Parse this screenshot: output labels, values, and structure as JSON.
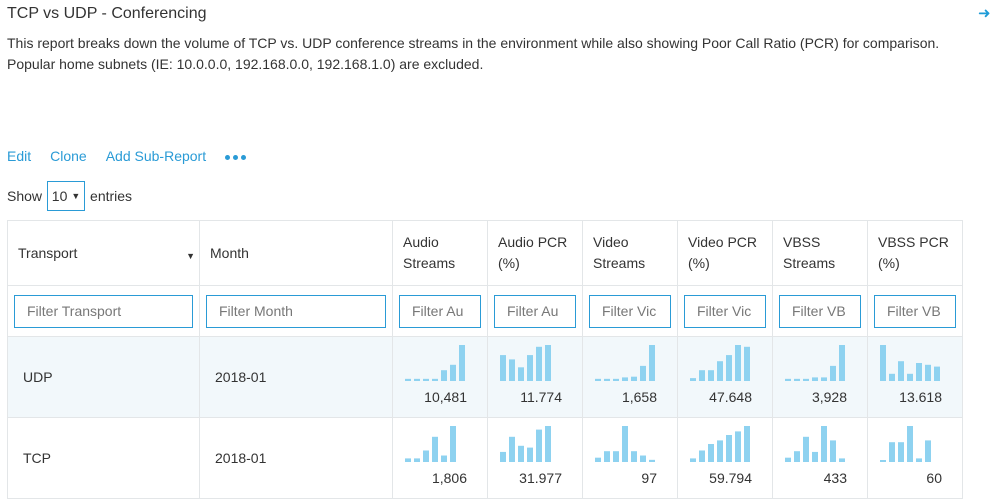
{
  "report": {
    "title": "TCP vs UDP - Conferencing",
    "description": "This report breaks down the volume of TCP vs. UDP conference streams in the environment while also showing Poor Call Ratio (PCR) for comparison. Popular home subnets (IE: 10.0.0.0, 192.168.0.0, 192.168.1.0) are excluded.",
    "open_icon": "arrow-right-icon"
  },
  "actions": {
    "edit": "Edit",
    "clone": "Clone",
    "add_sub_report": "Add Sub-Report",
    "more_icon": "more-dots-icon"
  },
  "length_menu": {
    "show": "Show",
    "value": "10",
    "entries": "entries"
  },
  "colors": {
    "accent": "#2a9bd6",
    "bar": "#8ed2f0",
    "row_highlight": "#f2f8fb"
  },
  "table": {
    "headers": [
      "Transport",
      "Month",
      "Audio Streams",
      "Audio PCR (%)",
      "Video Streams",
      "Video PCR (%)",
      "VBSS Streams",
      "VBSS PCR (%)"
    ],
    "filters": [
      "Filter Transport",
      "Filter Month",
      "Filter Au",
      "Filter Au",
      "Filter Vic",
      "Filter Vic",
      "Filter VB",
      "Filter VB"
    ],
    "rows": [
      {
        "transport": "UDP",
        "month": "2018-01",
        "cells": [
          {
            "value": "10,481",
            "spark": [
              0.06,
              0.06,
              0.06,
              0.06,
              0.3,
              0.45,
              1.0
            ]
          },
          {
            "value": "11.774",
            "spark": [
              0.72,
              0.6,
              0.38,
              0.72,
              0.95,
              1.0
            ]
          },
          {
            "value": "1,658",
            "spark": [
              0.06,
              0.06,
              0.06,
              0.1,
              0.12,
              0.42,
              1.0
            ]
          },
          {
            "value": "47.648",
            "spark": [
              0.08,
              0.3,
              0.3,
              0.55,
              0.72,
              1.0,
              0.95
            ]
          },
          {
            "value": "3,928",
            "spark": [
              0.06,
              0.06,
              0.06,
              0.1,
              0.1,
              0.42,
              1.0
            ]
          },
          {
            "value": "13.618",
            "spark": [
              1.0,
              0.2,
              0.55,
              0.2,
              0.5,
              0.45,
              0.4
            ]
          }
        ]
      },
      {
        "transport": "TCP",
        "month": "2018-01",
        "cells": [
          {
            "value": "1,806",
            "spark": [
              0.1,
              0.1,
              0.32,
              0.7,
              0.18,
              1.0
            ]
          },
          {
            "value": "31.977",
            "spark": [
              0.28,
              0.7,
              0.45,
              0.4,
              0.9,
              1.0
            ]
          },
          {
            "value": "97",
            "spark": [
              0.12,
              0.3,
              0.3,
              1.0,
              0.3,
              0.18,
              0.06
            ]
          },
          {
            "value": "59.794",
            "spark": [
              0.1,
              0.32,
              0.5,
              0.6,
              0.75,
              0.85,
              1.0
            ]
          },
          {
            "value": "433",
            "spark": [
              0.12,
              0.3,
              0.7,
              0.28,
              1.0,
              0.6,
              0.1
            ]
          },
          {
            "value": "60",
            "spark": [
              0.04,
              0.55,
              0.55,
              1.0,
              0.1,
              0.6
            ]
          }
        ]
      }
    ]
  }
}
